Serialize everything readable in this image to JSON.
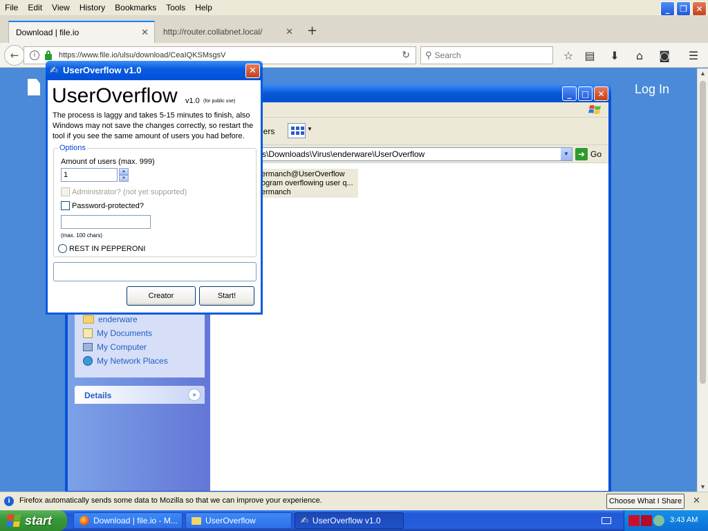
{
  "firefox": {
    "menu": [
      "File",
      "Edit",
      "View",
      "History",
      "Bookmarks",
      "Tools",
      "Help"
    ],
    "tabs": [
      {
        "label": "Download | file.io",
        "active": true
      },
      {
        "label": "http://router.collabnet.local/",
        "active": false
      }
    ],
    "url": "https://www.file.io/ulsu/download/CeaIQKSMsgsV",
    "search_placeholder": "Search",
    "window_controls": {
      "minimize": "_",
      "restore": "❐",
      "close": "✕"
    }
  },
  "webpage": {
    "login_label": "Log In"
  },
  "explorer": {
    "toolbar_folders_label": "ders",
    "address": "nts\\Downloads\\Virus\\enderware\\UserOverflow",
    "go_label": "Go",
    "file_item": {
      "line1": "ermanch@UserOverflow",
      "line2": "ogram overflowing user q...",
      "line3": "ermanch"
    },
    "other_places": [
      "enderware",
      "My Documents",
      "My Computer",
      "My Network Places"
    ],
    "details_title": "Details"
  },
  "dialog": {
    "title": "UserOverflow v1.0",
    "big_title": "UserOverflow",
    "version": "v1.0",
    "public_note": "(for public use)",
    "description": "The process is laggy and takes 5-15 minutes to finish, also Windows may not save the changes correctly, so restart the tool if you see the same amount of users you had before.",
    "options_label": "Options",
    "amount_label": "Amount of users (max. 999)",
    "amount_value": "1",
    "admin_label": "Administrator? (not yet supported)",
    "password_label": "Password-protected?",
    "password_value": "",
    "max_chars_label": "(max. 100 chars)",
    "radio_label": "REST IN PEPPERONI",
    "progress_value": 0,
    "creator_button": "Creator",
    "start_button": "Start!"
  },
  "notification": {
    "text": "Firefox automatically sends some data to Mozilla so that we can improve your experience.",
    "button": "Choose What I Share",
    "close": "✕"
  },
  "taskbar": {
    "start_label": "start",
    "buttons": [
      {
        "label": "Download | file.io - M...",
        "icon": "firefox-icon"
      },
      {
        "label": "UserOverflow",
        "icon": "folder-icon"
      },
      {
        "label": "UserOverflow v1.0",
        "icon": "app-icon"
      }
    ],
    "clock": "3:43 AM"
  }
}
